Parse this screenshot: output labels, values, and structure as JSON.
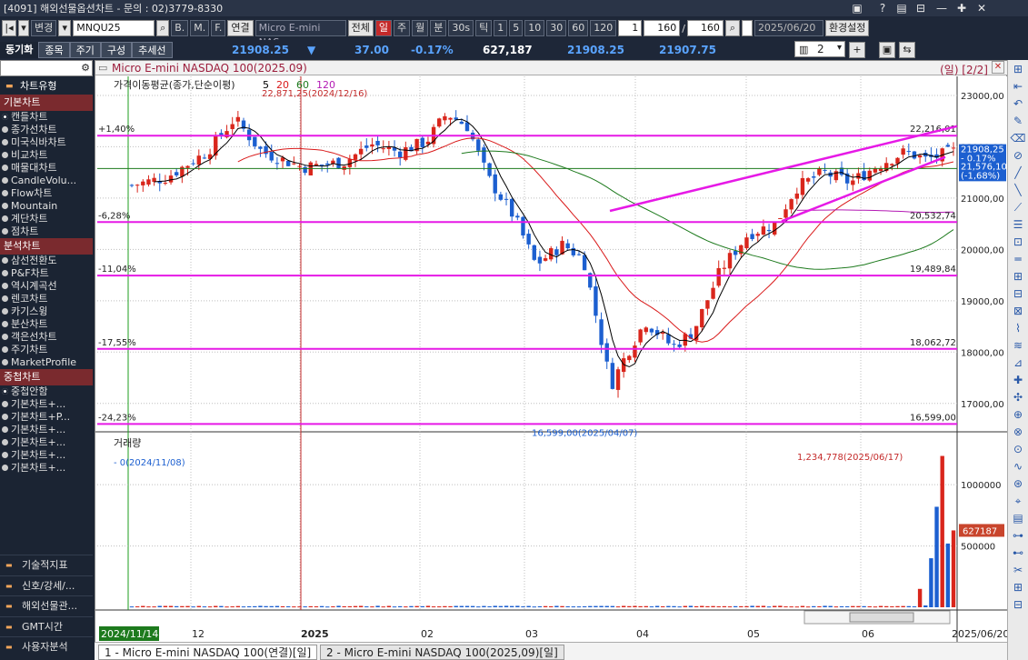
{
  "titlebar": {
    "text": "[4091] 해외선물옵션차트 - 문의 : 02)3779-8330"
  },
  "toolbar1": {
    "change_label": "변경",
    "code": "MNQU25",
    "opt_b": "B.",
    "opt_m": "M.",
    "opt_f": "F.",
    "link_label": "연결",
    "instrument": "Micro E-mini NAS",
    "all_label": "전체",
    "periods": [
      "일",
      "주",
      "월",
      "분",
      "30s",
      "틱"
    ],
    "nums": [
      "1",
      "5",
      "10",
      "30",
      "60",
      "120"
    ],
    "interval": "1",
    "count_a": "160",
    "count_b": "160",
    "date": "2025/06/20",
    "env_label": "환경설정"
  },
  "toolbar2": {
    "tabs": [
      "동기화",
      "종목",
      "주기",
      "구성",
      "추세선"
    ],
    "price": "21908.25",
    "change": "37.00",
    "pct": "-0.17%",
    "volume": "627,187",
    "price2": "21908.25",
    "price3": "21907.75",
    "layout_num": "2"
  },
  "sidebar": {
    "header": "차트유형",
    "basic_header": "기본차트",
    "basic_items": [
      "캔들차트",
      "종가선차트",
      "미국식바차트",
      "비교차트",
      "매물대차트",
      "CandleVolu...",
      "Flow차트",
      "Mountain",
      "계단차트",
      "점차트"
    ],
    "analysis_header": "분석차트",
    "analysis_items": [
      "삼선전환도",
      "P&F차트",
      "역시계곡선",
      "렌코차트",
      "카기스윙",
      "분산차트",
      "객은선차트",
      "주기차트",
      "MarketProfile"
    ],
    "overlay_header": "중첩차트",
    "overlay_items": [
      "중첩안함",
      "기본차트+...",
      "기본차트+P...",
      "기본차트+...",
      "기본차트+...",
      "기본차트+...",
      "기본차트+..."
    ],
    "bottom_items": [
      "기술적지표",
      "신호/강세/...",
      "해외선물관...",
      "GMT시간",
      "사용자분석"
    ]
  },
  "chart": {
    "title": "Micro E-mini NASDAQ 100(2025.09)",
    "period_label": "(일) [2/2]",
    "ma_label": "가격이동평균(종가,단순이평)",
    "ma_periods": [
      "5",
      "20",
      "60",
      "120"
    ],
    "ma_colors": [
      "#000000",
      "#d91a1a",
      "#1d7a1d",
      "#b41ab4"
    ],
    "price_ticks": [
      "23000,00",
      "22000,00",
      "21000,00",
      "20000,00",
      "19000,00",
      "18000,00",
      "17000,00"
    ],
    "hlines": [
      {
        "left": "+1,40%",
        "right": "22,216,01"
      },
      {
        "left": "-6,28%",
        "right": "20,532,74"
      },
      {
        "left": "-11,04%",
        "right": "19,489,84"
      },
      {
        "left": "-17,55%",
        "right": "18,062,72"
      },
      {
        "left": "-24,23%",
        "right": "16,599,00"
      }
    ],
    "high_note": "22,871,25(2024/12/16)",
    "low_note": "16,599,00(2025/04/07)",
    "last_price": "21908,25",
    "last_change": "- 0,17%",
    "ref_price": "21,576,10",
    "ref_change": "(-1,68%)",
    "volume_label": "거래량",
    "volume_high_note": "1,234,778(2025/06/17)",
    "volume_zero_note": "- 0(2024/11/08)",
    "volume_ticks": [
      "1000000",
      "500000"
    ],
    "volume_last": "627187",
    "x_start": "2024/11/14",
    "x_end": "2025/06/20",
    "x_labels": [
      "12",
      "2025",
      "02",
      "03",
      "04",
      "05",
      "06"
    ]
  },
  "bottom_tabs": [
    "1 - Micro E-mini NASDAQ 100(연결)[일]",
    "2 - Micro E-mini NASDAQ 100(2025,09)[일]"
  ],
  "chart_data": {
    "type": "candlestick",
    "title": "Micro E-mini NASDAQ 100(2025.09)",
    "x_range": [
      "2024/11/14",
      "2025/06/20"
    ],
    "ylim": [
      16500,
      23300
    ],
    "high": {
      "value": 22871.25,
      "date": "2024/12/16"
    },
    "low": {
      "value": 16599.0,
      "date": "2025/04/07"
    },
    "levels": [
      22216.01,
      20532.74,
      19489.84,
      18062.72,
      16599.0
    ],
    "monthly_closes": [
      {
        "x": "2024/11/14",
        "y": 21250
      },
      {
        "x": "2024/12",
        "y": 21900
      },
      {
        "x": "2024/12/16",
        "y": 22500
      },
      {
        "x": "2025/01",
        "y": 21500
      },
      {
        "x": "2025/02",
        "y": 21900
      },
      {
        "x": "2025/02/18",
        "y": 22600
      },
      {
        "x": "2025/03",
        "y": 20600
      },
      {
        "x": "2025/03/10",
        "y": 19700
      },
      {
        "x": "2025/04/07",
        "y": 17300
      },
      {
        "x": "2025/04/21",
        "y": 18300
      },
      {
        "x": "2025/05",
        "y": 20200
      },
      {
        "x": "2025/05/12",
        "y": 21200
      },
      {
        "x": "2025/06",
        "y": 21700
      },
      {
        "x": "2025/06/20",
        "y": 21908.25
      }
    ],
    "volume": {
      "last": 627187,
      "max": {
        "value": 1234778,
        "date": "2025/06/17"
      }
    }
  }
}
